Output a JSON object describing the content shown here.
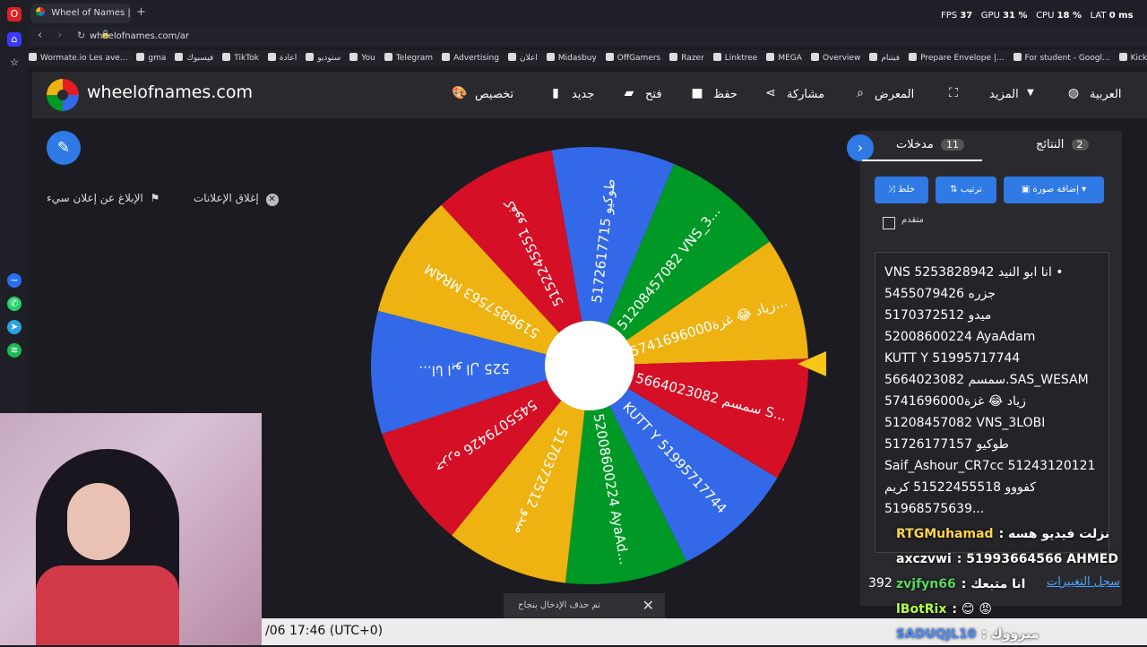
{
  "browser": {
    "tab_title": "Wheel of Names | عجلة",
    "url": "wheelofnames.com/ar",
    "bookmarks": [
      "Wormate.io Les ave...",
      "gma",
      "فيسبوك",
      "TikTok",
      "اعادة",
      "ستوديو",
      "You",
      "Telegram",
      "Advertising",
      "اعلان",
      "Midasbuy",
      "OffGamers",
      "Razer",
      "Linktree",
      "MEGA",
      "Overview",
      "فيتنام",
      "Prepare Envelope |...",
      "For student - Googl...",
      "Kick Dashboard"
    ]
  },
  "hud": {
    "fps_label": "FPS",
    "fps": "37",
    "gpu_label": "GPU",
    "gpu": "31 %",
    "cpu_label": "CPU",
    "cpu": "18 %",
    "lat_label": "LAT",
    "lat": "0 ms"
  },
  "site": {
    "name": "wheelofnames.com",
    "nav": {
      "customize": "تخصيص",
      "new": "جديد",
      "open": "فتح",
      "save": "حفظ",
      "share": "مشاركة",
      "gallery": "المعرض",
      "more": "المزيد",
      "language": "العربية"
    }
  },
  "ads": {
    "close": "إغلاق الإعلانات",
    "report": "الإبلاغ عن إعلان سيء"
  },
  "wheel": {
    "segments": [
      {
        "label": "5172617715 طوكيو",
        "color": "#3369e8"
      },
      {
        "label": "51208457082 VNS_3...",
        "color": "#009925"
      },
      {
        "label": "5741696000زياد 😂 غزة...",
        "color": "#eeb211"
      },
      {
        "label": "5664023082 سمسم S...",
        "color": "#d50f25"
      },
      {
        "label": "KUTT Y 51995717744",
        "color": "#3369e8"
      },
      {
        "label": "52008600224 AyaAd...",
        "color": "#009925"
      },
      {
        "label": "5170372512 ميدو",
        "color": "#eeb211"
      },
      {
        "label": "5455079426 جزره",
        "color": "#d50f25"
      },
      {
        "label": "525 انا ابو ال...",
        "color": "#3369e8"
      },
      {
        "label": "5196857563 MRAM",
        "color": "#eeb211"
      },
      {
        "label": "5152245551 كفوو",
        "color": "#d50f25"
      }
    ]
  },
  "panel": {
    "tab_entries": "مدخلات",
    "tab_entries_count": "11",
    "tab_results": "النتائج",
    "tab_results_count": "2",
    "btn_shuffle": "خلط",
    "btn_sort": "ترتيب",
    "btn_add_image": "إضافة صورة",
    "advanced": "متقدم",
    "entries": [
      "VNS انا ابو النيد 5253828942 •",
      "جزره 5455079426",
      "ميدو 5170372512",
      "52008600224 AyaAdam",
      "KUTT Y  51995717744",
      "5664023082 سمسم.SAS_WESAM",
      "5741696000زياد 😂 غزة",
      "51208457082 VNS_3LOBI",
      "51726177157 طوكيو",
      "Saif_Ashour_CR7cc 51243120121",
      "كفووو 51522455518 كريم",
      "51968575639..."
    ],
    "count": "392",
    "changelog": "سجل التغييرات"
  },
  "toast": {
    "message": "تم حذف الإدخال بنجاح"
  },
  "stream": {
    "timestamp": "/06 17:46 (UTC+0)",
    "chat": [
      {
        "user": "RTGMuhamad",
        "msg": ": نزلت فيديو هسه",
        "color": "#ffd54a"
      },
      {
        "user": "axczvwi",
        "msg": ": 51993664566 AHMED",
        "color": "#ffffff"
      },
      {
        "user": "zvjfyn66",
        "msg": ": انا متبعك",
        "color": "#5ad65a"
      },
      {
        "user": "lBotRix",
        "msg": ": 😊 😡",
        "color": "#b6ff4a"
      },
      {
        "user": "SADUQJL10",
        "msg": ": ميرووك",
        "color": "#4a8cff"
      }
    ]
  }
}
